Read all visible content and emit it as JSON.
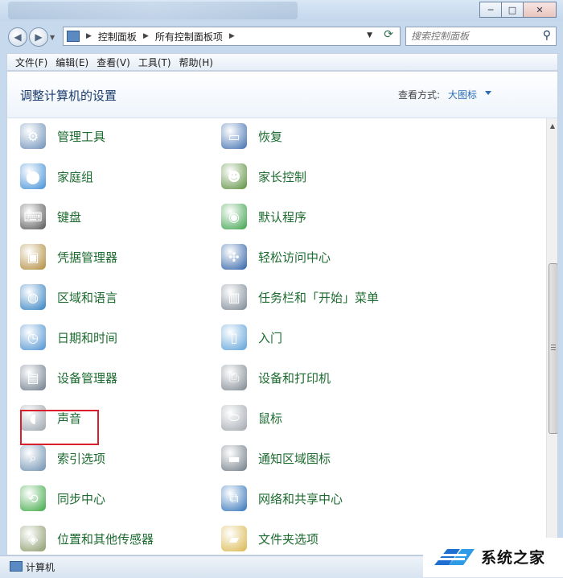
{
  "window": {
    "controls": {
      "minimize": "─",
      "maximize": "□",
      "close": "✕"
    }
  },
  "address_bar": {
    "breadcrumbs": [
      "控制面板",
      "所有控制面板项"
    ],
    "search_placeholder": "搜索控制面板"
  },
  "menu": [
    "文件(F)",
    "编辑(E)",
    "查看(V)",
    "工具(T)",
    "帮助(H)"
  ],
  "header": {
    "title": "调整计算机的设置",
    "view_by_label": "查看方式:",
    "view_by_value": "大图标"
  },
  "items": {
    "left": [
      {
        "label": "管理工具",
        "icon": "admin-tools-icon",
        "color": "#6a8fb8"
      },
      {
        "label": "家庭组",
        "icon": "homegroup-icon",
        "color": "#3f8ed8"
      },
      {
        "label": "键盘",
        "icon": "keyboard-icon",
        "color": "#555555"
      },
      {
        "label": "凭据管理器",
        "icon": "credential-vault-icon",
        "color": "#b08a3a"
      },
      {
        "label": "区域和语言",
        "icon": "globe-icon",
        "color": "#2f7fc1"
      },
      {
        "label": "日期和时间",
        "icon": "calendar-clock-icon",
        "color": "#4a90d0"
      },
      {
        "label": "设备管理器",
        "icon": "device-manager-icon",
        "color": "#6b7a8a"
      },
      {
        "label": "声音",
        "icon": "speaker-icon",
        "color": "#9aa4ad"
      },
      {
        "label": "索引选项",
        "icon": "index-search-icon",
        "color": "#6c8fb0"
      },
      {
        "label": "同步中心",
        "icon": "sync-center-icon",
        "color": "#3da844"
      },
      {
        "label": "位置和其他传感器",
        "icon": "sensor-icon",
        "color": "#8a9a6a"
      }
    ],
    "right": [
      {
        "label": "恢复",
        "icon": "recovery-icon",
        "color": "#3e6fb0"
      },
      {
        "label": "家长控制",
        "icon": "parental-controls-icon",
        "color": "#5a8f3c"
      },
      {
        "label": "默认程序",
        "icon": "default-programs-icon",
        "color": "#3aa14a"
      },
      {
        "label": "轻松访问中心",
        "icon": "ease-of-access-icon",
        "color": "#2c5fa6"
      },
      {
        "label": "任务栏和「开始」菜单",
        "icon": "taskbar-icon",
        "color": "#7a8794"
      },
      {
        "label": "入门",
        "icon": "getting-started-icon",
        "color": "#5aa0d8"
      },
      {
        "label": "设备和打印机",
        "icon": "printer-icon",
        "color": "#7d8790"
      },
      {
        "label": "鼠标",
        "icon": "mouse-icon",
        "color": "#a0a6ad"
      },
      {
        "label": "通知区域图标",
        "icon": "notification-area-icon",
        "color": "#6f7b86"
      },
      {
        "label": "网络和共享中心",
        "icon": "network-sharing-icon",
        "color": "#2f72b8"
      },
      {
        "label": "文件夹选项",
        "icon": "folder-options-icon",
        "color": "#d9b64a"
      }
    ]
  },
  "status": {
    "text": "计算机"
  },
  "watermark": {
    "text": "系统之家"
  },
  "colors": {
    "link": "#1c6b2f",
    "title": "#1b3d6e",
    "highlight": "#d8202c"
  }
}
